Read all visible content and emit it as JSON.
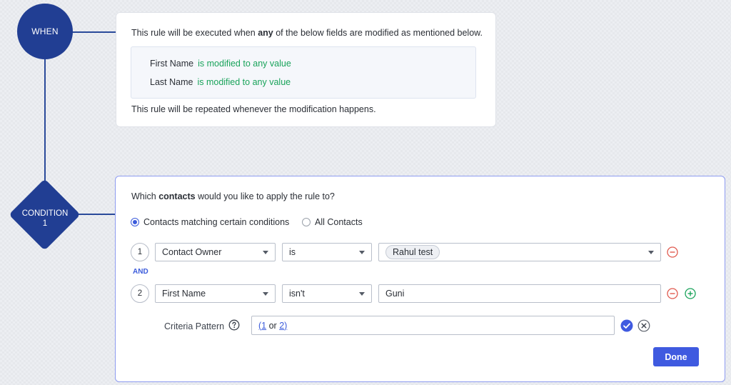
{
  "when": {
    "node_label": "WHEN",
    "intro_before": "This rule will be executed when ",
    "intro_bold": "any",
    "intro_after": " of the below fields are modified as mentioned below.",
    "fields": [
      {
        "name": "First Name",
        "modifier_prefix": "is modified to",
        "modifier_value": "any value"
      },
      {
        "name": "Last Name",
        "modifier_prefix": "is modified to",
        "modifier_value": "any value"
      }
    ],
    "outro": "This rule will be repeated whenever the modification happens."
  },
  "condition": {
    "node_label_line1": "CONDITION",
    "node_label_line2": "1",
    "question_before": "Which ",
    "question_bold": "contacts",
    "question_after": " would you like to apply the rule to?",
    "radio_options": [
      "Contacts matching certain conditions",
      "All Contacts"
    ],
    "selected_radio": "Contacts matching certain conditions",
    "join_label": "AND",
    "criteria": [
      {
        "index": "1",
        "field": "Contact Owner",
        "operator": "is",
        "value": "Rahul test"
      },
      {
        "index": "2",
        "field": "First Name",
        "operator": "isn't",
        "value": "Guni"
      }
    ],
    "criteria_pattern_label": "Criteria Pattern",
    "pattern": {
      "open": "(",
      "first": "1",
      "join": " or ",
      "second": "2",
      "close": ")"
    },
    "done_label": "Done"
  },
  "colors": {
    "node": "#213e93",
    "accent": "#3f5ae0",
    "modified_text": "#19a35a",
    "remove_icon": "#e05a4f",
    "add_icon": "#1aa35b"
  }
}
